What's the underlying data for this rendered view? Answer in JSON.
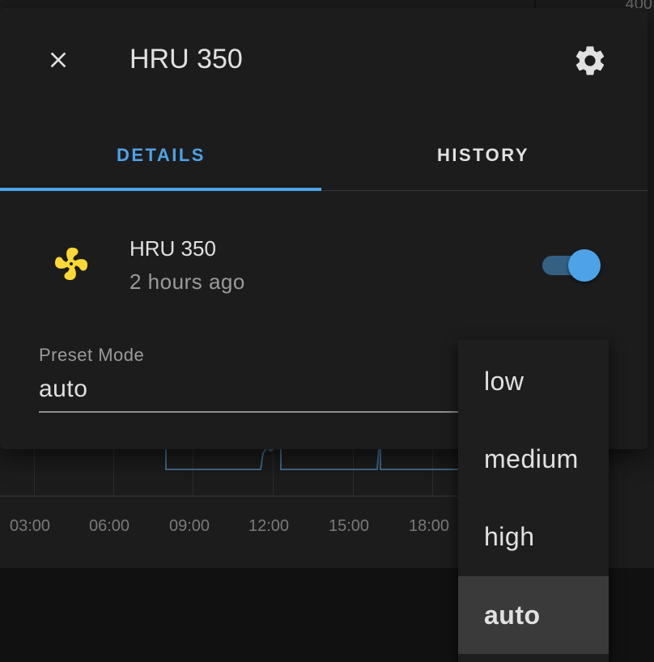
{
  "background": {
    "time_ticks": [
      "03:00",
      "06:00",
      "09:00",
      "12:00",
      "15:00",
      "18:00"
    ],
    "corner_label": "400"
  },
  "dialog": {
    "title": "HRU 350",
    "close_icon": "close-icon",
    "settings_icon": "gear-icon",
    "tabs": [
      {
        "label": "DETAILS",
        "active": true
      },
      {
        "label": "HISTORY",
        "active": false
      }
    ],
    "entity": {
      "icon": "fan-icon",
      "icon_color": "#fdd835",
      "name": "HRU 350",
      "last_changed": "2 hours ago",
      "toggle_on": true
    },
    "preset": {
      "label": "Preset Mode",
      "value": "auto"
    }
  },
  "dropdown": {
    "options": [
      "low",
      "medium",
      "high",
      "auto"
    ],
    "selected": "auto"
  },
  "colors": {
    "accent": "#4ea3e8",
    "surface": "#1c1c1c",
    "fan": "#fdd835"
  }
}
